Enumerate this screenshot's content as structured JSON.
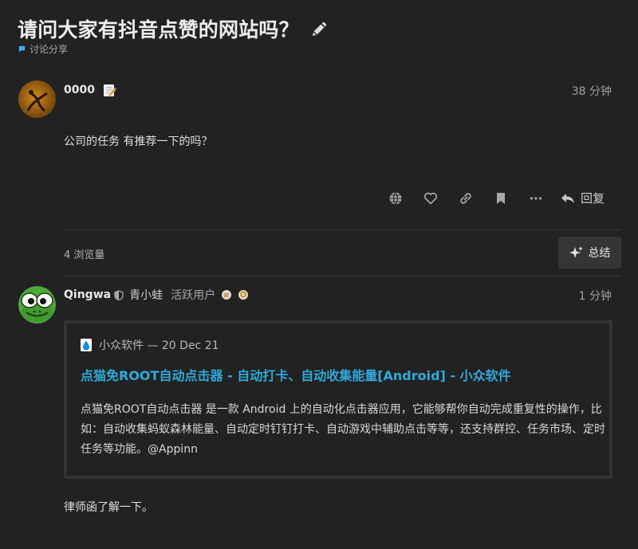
{
  "topic": {
    "title": "请问大家有抖音点赞的网站吗？",
    "category": "讨论分享",
    "category_color": "#3ab0ff"
  },
  "post1": {
    "username": "0000",
    "status_icon": "memo-icon",
    "time": "38 分钟",
    "body": "公司的任务 有推荐一下的吗？",
    "actions": [
      "globe-icon",
      "heart-icon",
      "link-icon",
      "bookmark-icon",
      "more-icon"
    ],
    "reply_label": "回复"
  },
  "stats": {
    "views": "4 浏览量",
    "summary_label": "总结"
  },
  "post2": {
    "username": "Qingwa",
    "full_name": "青小蛙",
    "user_title": "活跃用户",
    "time": "1 分钟",
    "onebox": {
      "source": "小众软件 — 20 Dec 21",
      "title": "点猫免ROOT自动点击器 - 自动打卡、自动收集能量[Android] - 小众软件",
      "description": "点猫免ROOT自动点击器 是一款 Android 上的自动化点击器应用，它能够帮你自动完成重复性的操作，比如：自动收集蚂蚁森林能量、自动定时钉钉打卡、自动游戏中辅助点击等等，还支持群控、任务市场、定时任务等功能。@Appinn",
      "link_color": "#2eaadc"
    },
    "body": "律师函了解一下。"
  }
}
